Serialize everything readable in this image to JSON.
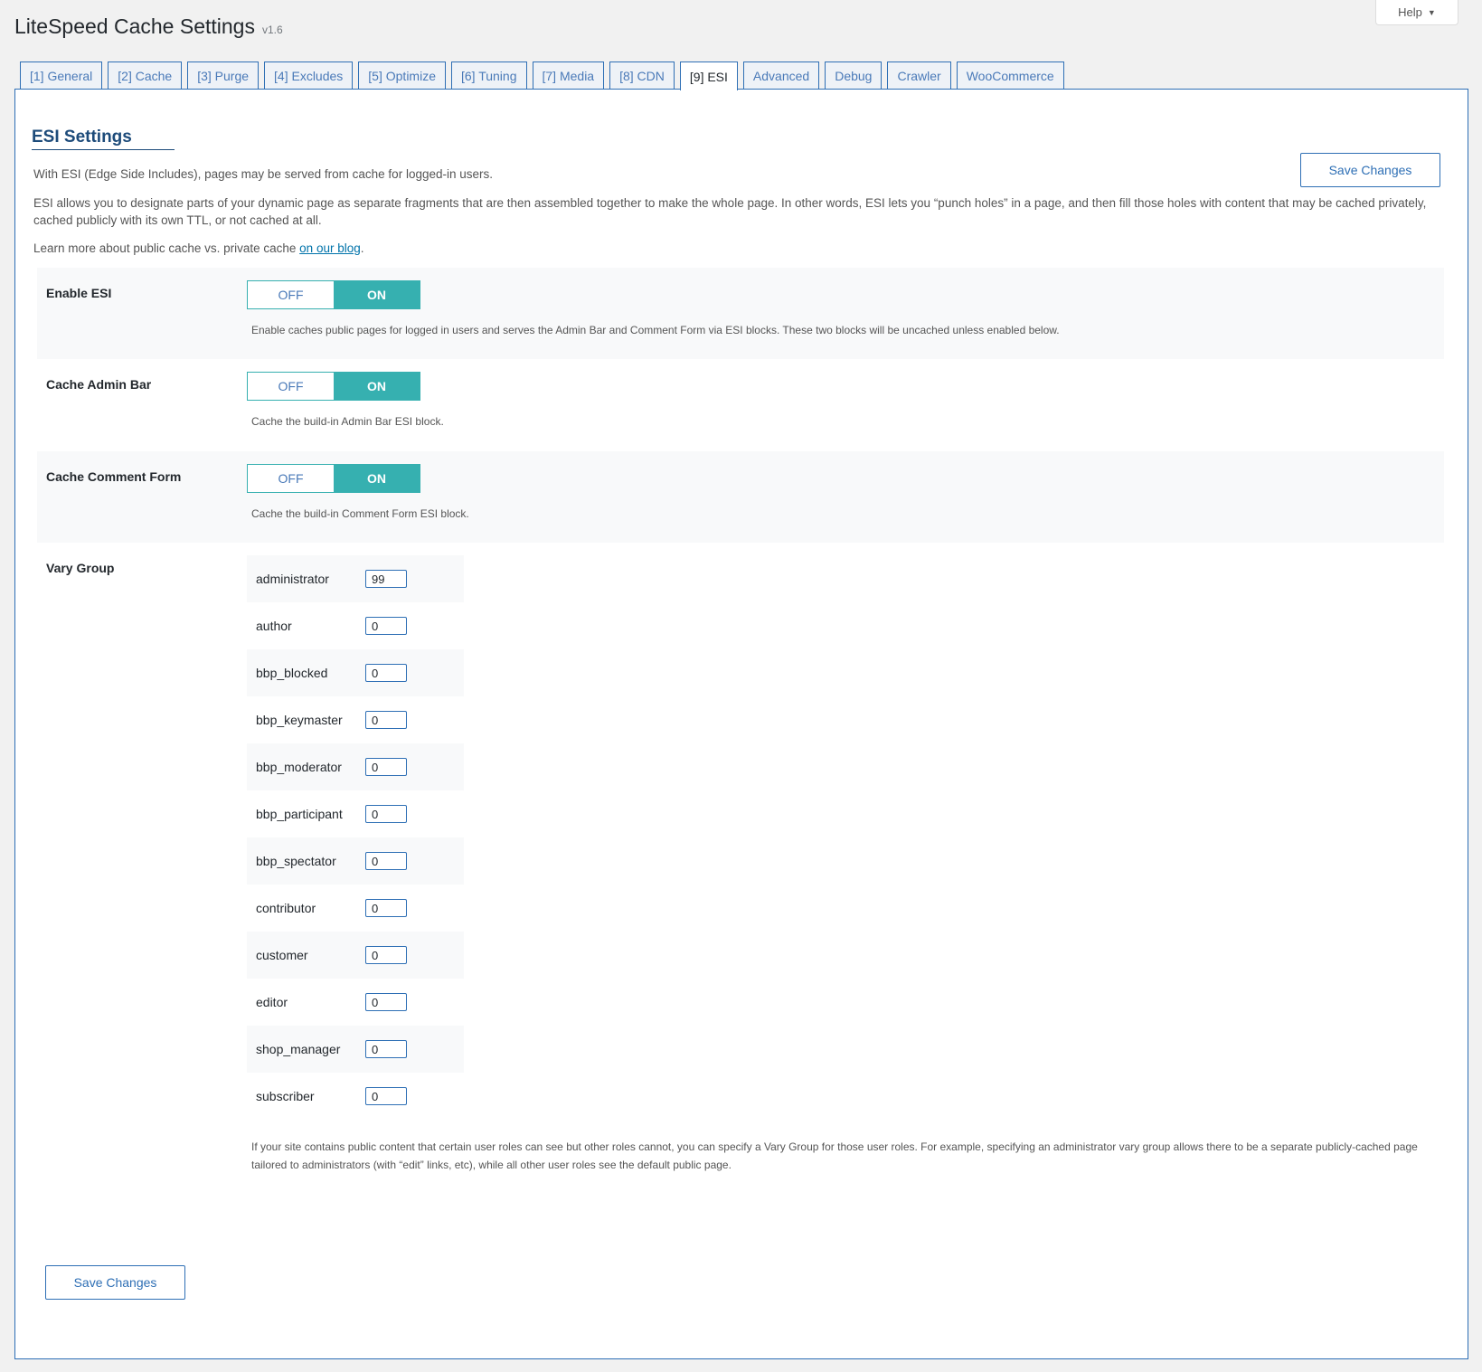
{
  "header": {
    "title": "LiteSpeed Cache Settings",
    "version": "v1.6",
    "help_label": "Help"
  },
  "tabs": [
    {
      "label": "[1] General",
      "active": false
    },
    {
      "label": "[2] Cache",
      "active": false
    },
    {
      "label": "[3] Purge",
      "active": false
    },
    {
      "label": "[4] Excludes",
      "active": false
    },
    {
      "label": "[5] Optimize",
      "active": false
    },
    {
      "label": "[6] Tuning",
      "active": false
    },
    {
      "label": "[7] Media",
      "active": false
    },
    {
      "label": "[8] CDN",
      "active": false
    },
    {
      "label": "[9] ESI",
      "active": true
    },
    {
      "label": "Advanced",
      "active": false
    },
    {
      "label": "Debug",
      "active": false
    },
    {
      "label": "Crawler",
      "active": false
    },
    {
      "label": "WooCommerce",
      "active": false
    }
  ],
  "esi": {
    "section_title": "ESI Settings",
    "save_label": "Save Changes",
    "intro_1": "With ESI (Edge Side Includes), pages may be served from cache for logged-in users.",
    "intro_2": "ESI allows you to designate parts of your dynamic page as separate fragments that are then assembled together to make the whole page. In other words, ESI lets you “punch holes” in a page, and then fill those holes with content that may be cached privately, cached publicly with its own TTL, or not cached at all.",
    "intro_3_prefix": "Learn more about public cache vs. private cache ",
    "intro_3_link": "on our blog",
    "intro_3_suffix": "."
  },
  "settings": {
    "enable_esi": {
      "label": "Enable ESI",
      "off_label": "OFF",
      "on_label": "ON",
      "value": "ON",
      "description": "Enable caches public pages for logged in users and serves the Admin Bar and Comment Form via ESI blocks. These two blocks will be uncached unless enabled below."
    },
    "cache_admin_bar": {
      "label": "Cache Admin Bar",
      "off_label": "OFF",
      "on_label": "ON",
      "value": "ON",
      "description": "Cache the build-in Admin Bar ESI block."
    },
    "cache_comment_form": {
      "label": "Cache Comment Form",
      "off_label": "OFF",
      "on_label": "ON",
      "value": "ON",
      "description": "Cache the build-in Comment Form ESI block."
    },
    "vary_group": {
      "label": "Vary Group",
      "roles": [
        {
          "role": "administrator",
          "value": "99"
        },
        {
          "role": "author",
          "value": "0"
        },
        {
          "role": "bbp_blocked",
          "value": "0"
        },
        {
          "role": "bbp_keymaster",
          "value": "0"
        },
        {
          "role": "bbp_moderator",
          "value": "0"
        },
        {
          "role": "bbp_participant",
          "value": "0"
        },
        {
          "role": "bbp_spectator",
          "value": "0"
        },
        {
          "role": "contributor",
          "value": "0"
        },
        {
          "role": "customer",
          "value": "0"
        },
        {
          "role": "editor",
          "value": "0"
        },
        {
          "role": "shop_manager",
          "value": "0"
        },
        {
          "role": "subscriber",
          "value": "0"
        }
      ],
      "description": "If your site contains public content that certain user roles can see but other roles cannot, you can specify a Vary Group for those user roles. For example, specifying an administrator vary group allows there to be a separate publicly-cached page tailored to administrators (with “edit” links, etc), while all other user roles see the default public page."
    }
  },
  "footer": {
    "save_label": "Save Changes"
  },
  "colors": {
    "accent": "#2e6fb5",
    "toggle_on": "#36b0b0",
    "background": "#f1f1f1"
  }
}
